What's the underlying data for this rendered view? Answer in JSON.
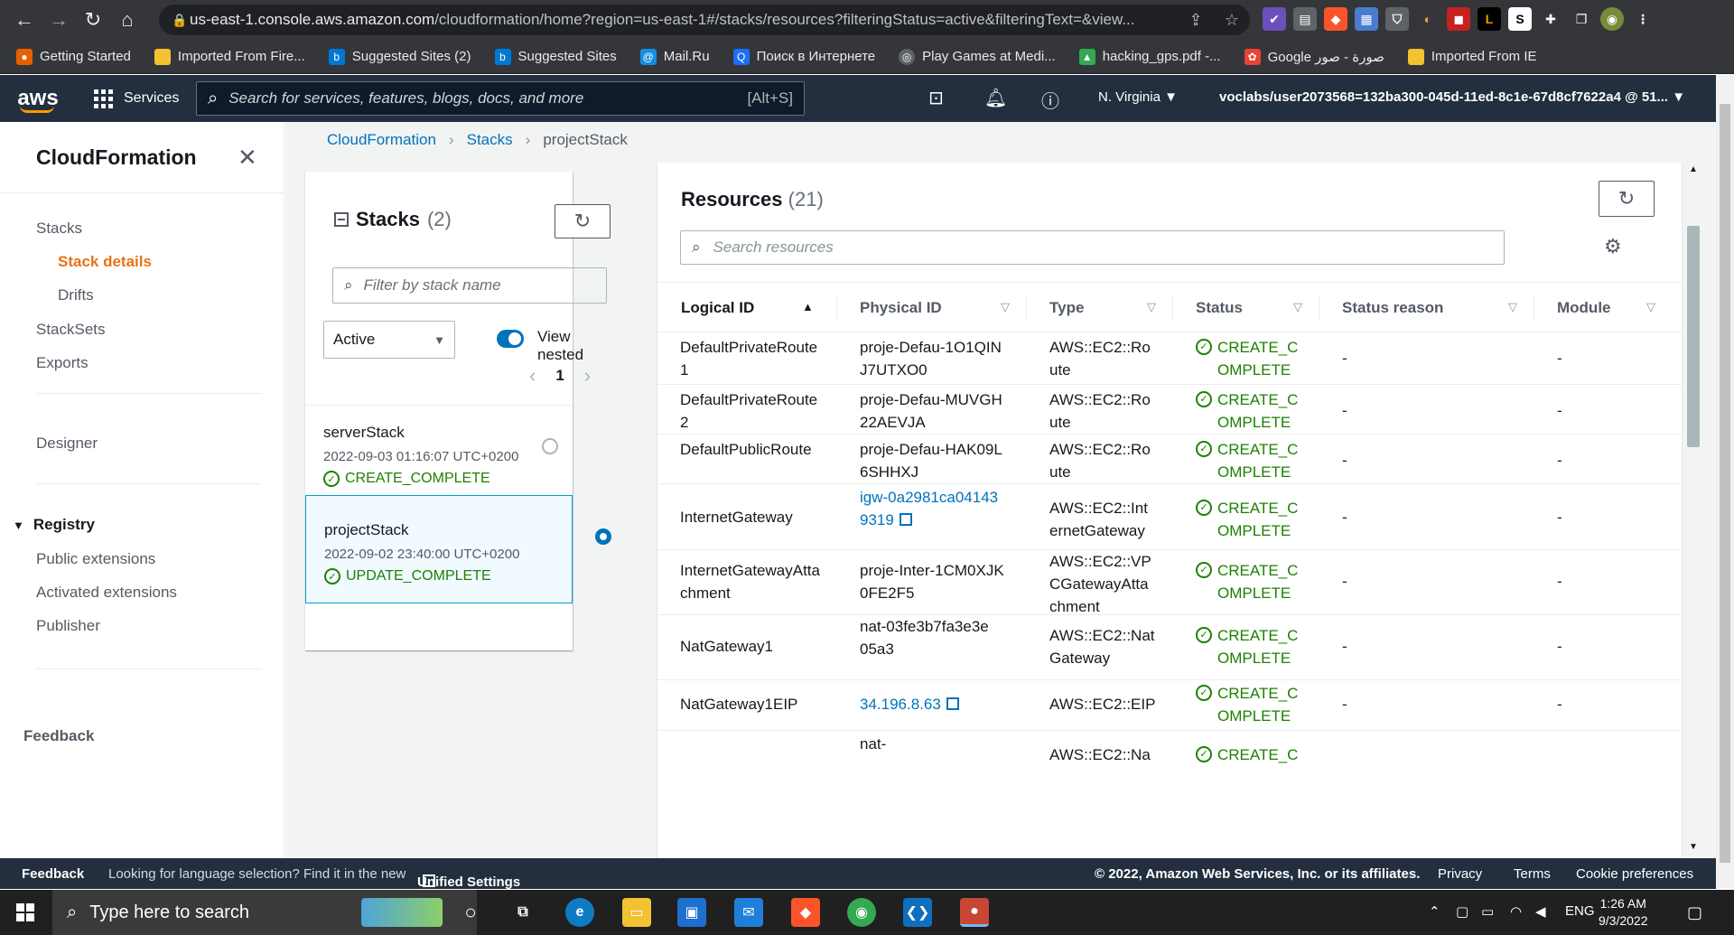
{
  "browser": {
    "url_host": "us-east-1.console.aws.amazon.com",
    "url_path": "/cloudformation/home?region=us-east-1#/stacks/resources?filteringStatus=active&filteringText=&view...",
    "bookmarks": [
      "Getting Started",
      "Imported From Fire...",
      "Suggested Sites (2)",
      "Suggested Sites",
      "Mail.Ru",
      "Поиск в Интернете",
      "Play Games at Medi...",
      "hacking_gps.pdf -...",
      "Google صورة - صور",
      "Imported From IE"
    ]
  },
  "aws": {
    "logo": "aws",
    "services_label": "Services",
    "search_placeholder": "Search for services, features, blogs, docs, and more",
    "search_shortcut": "[Alt+S]",
    "region": "N. Virginia ▼",
    "account": "voclabs/user2073568=132ba300-045d-11ed-8c1e-67d8cf7622a4 @ 51... ▼"
  },
  "sidenav": {
    "title": "CloudFormation",
    "items": [
      "Stacks",
      "Stack details",
      "Drifts",
      "StackSets",
      "Exports",
      "Designer"
    ],
    "registry_label": "Registry",
    "registry_items": [
      "Public extensions",
      "Activated extensions",
      "Publisher"
    ],
    "feedback": "Feedback"
  },
  "breadcrumb": [
    "CloudFormation",
    "Stacks",
    "projectStack"
  ],
  "stacks_panel": {
    "title": "Stacks",
    "count": "(2)",
    "filter_placeholder": "Filter by stack name",
    "status_filter": "Active",
    "view_nested_label": "View nested",
    "view_nested_on": true,
    "page": "1",
    "stacks": [
      {
        "name": "serverStack",
        "date": "2022-09-03 01:16:07 UTC+0200",
        "status": "CREATE_COMPLETE",
        "selected": false
      },
      {
        "name": "projectStack",
        "date": "2022-09-02 23:40:00 UTC+0200",
        "status": "UPDATE_COMPLETE",
        "selected": true
      }
    ]
  },
  "resources": {
    "title": "Resources",
    "count": "(21)",
    "search_placeholder": "Search resources",
    "columns": [
      "Logical ID",
      "Physical ID",
      "Type",
      "Status",
      "Status reason",
      "Module"
    ],
    "rows": [
      {
        "logical": "DefaultPrivateRoute1",
        "physical": "proje-Defau-1O1QINJ7UTXO0",
        "type": "AWS::EC2::Route",
        "status": "CREATE_COMPLETE",
        "reason": "-",
        "module": "-"
      },
      {
        "logical": "DefaultPrivateRoute2",
        "physical": "proje-Defau-MUVGH22AEVJA",
        "type": "AWS::EC2::Route",
        "status": "CREATE_COMPLETE",
        "reason": "-",
        "module": "-"
      },
      {
        "logical": "DefaultPublicRoute",
        "physical": "proje-Defau-HAK09L6SHHXJ",
        "type": "AWS::EC2::Route",
        "status": "CREATE_COMPLETE",
        "reason": "-",
        "module": "-"
      },
      {
        "logical": "InternetGateway",
        "physical": "igw-0a2981ca041439319",
        "type": "AWS::EC2::InternetGateway",
        "status": "CREATE_COMPLETE",
        "reason": "-",
        "module": "-"
      },
      {
        "logical": "InternetGatewayAttachment",
        "physical": "proje-Inter-1CM0XJK0FE2F5",
        "type": "AWS::EC2::VPCGatewayAttachment",
        "status": "CREATE_COMPLETE",
        "reason": "-",
        "module": "-"
      },
      {
        "logical": "NatGateway1",
        "physical": "nat-03fe3b7fa3e3e05a3",
        "type": "AWS::EC2::NatGateway",
        "status": "CREATE_COMPLETE",
        "reason": "-",
        "module": "-"
      },
      {
        "logical": "NatGateway1EIP",
        "physical": "34.196.8.63",
        "type": "AWS::EC2::EIP",
        "status": "CREATE_COMPLETE",
        "reason": "-",
        "module": "-"
      },
      {
        "logical": "",
        "physical": "nat-",
        "type": "AWS::EC2::Na",
        "status": "CREATE_C",
        "reason": "",
        "module": ""
      }
    ]
  },
  "footer": {
    "feedback": "Feedback",
    "lang_msg": "Looking for language selection? Find it in the new",
    "unified": "Unified Settings",
    "copyright": "© 2022, Amazon Web Services, Inc. or its affiliates.",
    "privacy": "Privacy",
    "terms": "Terms",
    "cookies": "Cookie preferences"
  },
  "taskbar": {
    "search_placeholder": "Type here to search",
    "lang": "ENG",
    "time": "1:26 AM",
    "date": "9/3/2022"
  }
}
